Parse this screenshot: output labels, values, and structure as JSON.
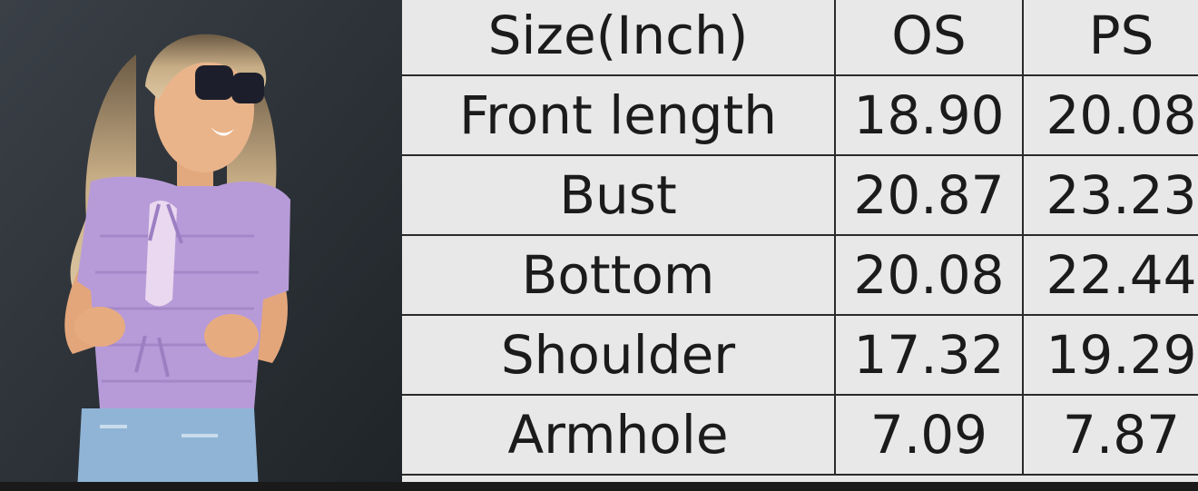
{
  "size_chart": {
    "headers": [
      "Size(Inch)",
      "OS",
      "PS"
    ],
    "rows": [
      [
        "Front length",
        "18.90",
        "20.08"
      ],
      [
        "Bust",
        "20.87",
        "23.23"
      ],
      [
        "Bottom",
        "20.08",
        "22.44"
      ],
      [
        "Shoulder",
        "17.32",
        "19.29"
      ],
      [
        "Armhole",
        "7.09",
        "7.87"
      ]
    ]
  },
  "colors": {
    "table_background": "#e8e8e8",
    "grid_lines": "#2a2a2a",
    "text": "#1b1b1b",
    "photo_background": "#2b3035",
    "sweater": "#b79bd8",
    "jeans": "#8fb4d6"
  }
}
